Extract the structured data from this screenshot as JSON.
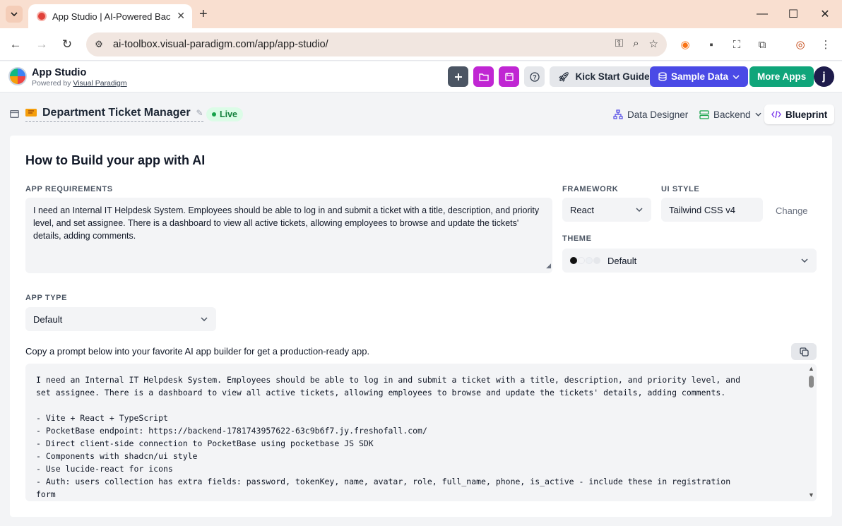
{
  "browser": {
    "tab_title": "App Studio | AI-Powered Backend",
    "url": "ai-toolbox.visual-paradigm.com/app/app-studio/"
  },
  "header": {
    "app_name": "App Studio",
    "powered_prefix": "Powered by",
    "powered_link": "Visual Paradigm",
    "kick_start": "Kick Start Guide",
    "sample_data": "Sample Data",
    "more_apps": "More Apps",
    "avatar_initial": "j"
  },
  "project": {
    "title": "Department Ticket Manager",
    "status": "Live",
    "tabs": {
      "data_designer": "Data Designer",
      "backend": "Backend",
      "blueprint": "Blueprint"
    }
  },
  "main": {
    "heading": "How to Build your app with AI",
    "req_label": "APP REQUIREMENTS",
    "requirements": "I need an Internal IT Helpdesk System. Employees should be able to log in and submit a ticket with a title, description, and priority level, and set assignee. There is a dashboard to view all active tickets, allowing employees to browse and update the tickets' details, adding comments.",
    "framework_label": "FRAMEWORK",
    "framework": "React",
    "ui_style_label": "UI STYLE",
    "ui_style": "Tailwind CSS v4",
    "change": "Change",
    "theme_label": "THEME",
    "theme": "Default",
    "theme_colors": [
      "#111111",
      "#f3f4f6",
      "#e5e7eb",
      "#d1d5db"
    ],
    "app_type_label": "APP TYPE",
    "app_type": "Default",
    "copy_hint": "Copy a prompt below into your favorite AI app builder for get a production-ready app.",
    "prompt": "I need an Internal IT Helpdesk System. Employees should be able to log in and submit a ticket with a title, description, and priority level, and set assignee. There is a dashboard to view all active tickets, allowing employees to browse and update the tickets' details, adding comments.\n\n- Vite + React + TypeScript\n- PocketBase endpoint: https://backend-1781743957622-63c9b6f7.jy.freshofall.com/\n- Direct client-side connection to PocketBase using pocketbase JS SDK\n- Components with shadcn/ui style\n- Use lucide-react for icons\n- Auth: users collection has extra fields: password, tokenKey, name, avatar, role, full_name, phone, is_active - include these in registration form"
  }
}
